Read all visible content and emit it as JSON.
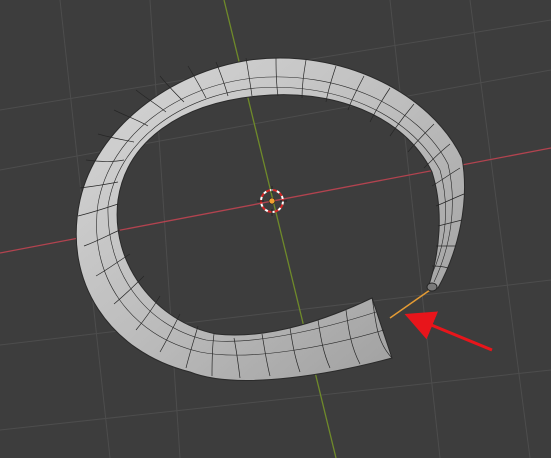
{
  "viewport": {
    "background": "#3d3d3d",
    "grid_color": "#4d4d4d",
    "axis_x_color": "#b2434f",
    "axis_y_color": "#6f8a2a"
  },
  "mesh": {
    "object_icon": "torus-tube-mesh",
    "surface_color": "#cfcfcf",
    "wire_color": "#262626",
    "selected_edge_color": "#e49b34"
  },
  "origin": {
    "icon": "3d-cursor-icon",
    "ring_color": "#d62828",
    "center_color": "#f0a030"
  },
  "annotation": {
    "icon": "red-arrow-icon",
    "color": "#e8151b"
  }
}
